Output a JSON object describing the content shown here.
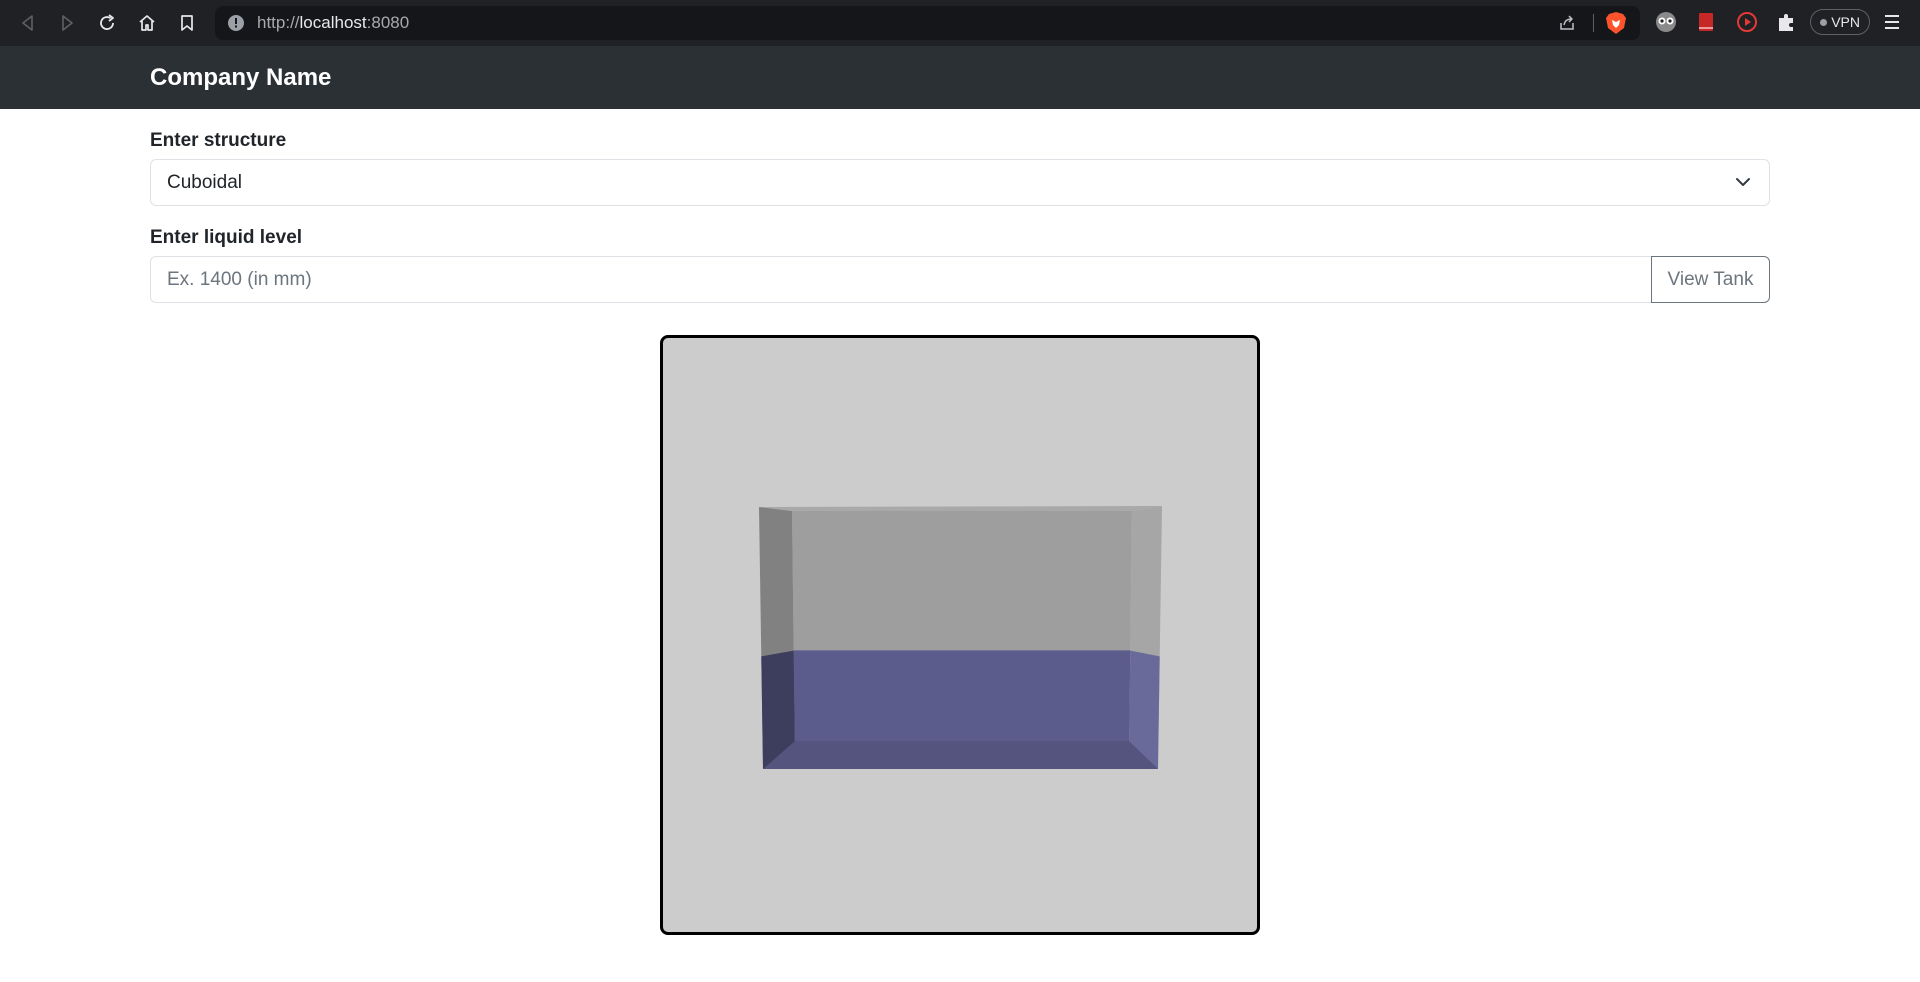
{
  "browser": {
    "url_scheme": "http://",
    "url_host": "localhost",
    "url_port": ":8080",
    "vpn_label": "VPN"
  },
  "header": {
    "brand": "Company Name"
  },
  "form": {
    "structure_label": "Enter structure",
    "structure_selected": "Cuboidal",
    "liquid_label": "Enter liquid level",
    "liquid_placeholder": "Ex. 1400 (in mm)",
    "liquid_value": "",
    "view_button": "View Tank"
  },
  "tank": {
    "shape": "cuboid",
    "liquid_fraction": 0.43,
    "colors": {
      "background": "#cccccc",
      "tank_wall": "#a0a0a0",
      "liquid": "#5c5c8c"
    }
  },
  "icons": {
    "back": "back-icon",
    "forward": "forward-icon",
    "reload": "reload-icon",
    "home": "home-icon",
    "bookmark": "bookmark-icon",
    "info": "info-icon",
    "share": "share-icon",
    "brave": "brave-lion-icon",
    "extension_1": "eyes-extension-icon",
    "extension_2": "red-book-extension-icon",
    "extension_3": "red-play-extension-icon",
    "extensions": "puzzle-icon",
    "menu": "hamburger-menu-icon"
  }
}
